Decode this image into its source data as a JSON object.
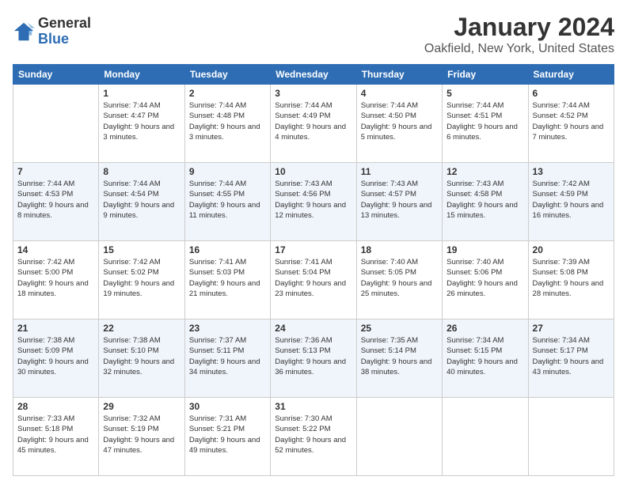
{
  "logo": {
    "general": "General",
    "blue": "Blue"
  },
  "header": {
    "title": "January 2024",
    "subtitle": "Oakfield, New York, United States"
  },
  "weekdays": [
    "Sunday",
    "Monday",
    "Tuesday",
    "Wednesday",
    "Thursday",
    "Friday",
    "Saturday"
  ],
  "weeks": [
    [
      {
        "num": "",
        "sunrise": "",
        "sunset": "",
        "daylight": ""
      },
      {
        "num": "1",
        "sunrise": "Sunrise: 7:44 AM",
        "sunset": "Sunset: 4:47 PM",
        "daylight": "Daylight: 9 hours and 3 minutes."
      },
      {
        "num": "2",
        "sunrise": "Sunrise: 7:44 AM",
        "sunset": "Sunset: 4:48 PM",
        "daylight": "Daylight: 9 hours and 3 minutes."
      },
      {
        "num": "3",
        "sunrise": "Sunrise: 7:44 AM",
        "sunset": "Sunset: 4:49 PM",
        "daylight": "Daylight: 9 hours and 4 minutes."
      },
      {
        "num": "4",
        "sunrise": "Sunrise: 7:44 AM",
        "sunset": "Sunset: 4:50 PM",
        "daylight": "Daylight: 9 hours and 5 minutes."
      },
      {
        "num": "5",
        "sunrise": "Sunrise: 7:44 AM",
        "sunset": "Sunset: 4:51 PM",
        "daylight": "Daylight: 9 hours and 6 minutes."
      },
      {
        "num": "6",
        "sunrise": "Sunrise: 7:44 AM",
        "sunset": "Sunset: 4:52 PM",
        "daylight": "Daylight: 9 hours and 7 minutes."
      }
    ],
    [
      {
        "num": "7",
        "sunrise": "Sunrise: 7:44 AM",
        "sunset": "Sunset: 4:53 PM",
        "daylight": "Daylight: 9 hours and 8 minutes."
      },
      {
        "num": "8",
        "sunrise": "Sunrise: 7:44 AM",
        "sunset": "Sunset: 4:54 PM",
        "daylight": "Daylight: 9 hours and 9 minutes."
      },
      {
        "num": "9",
        "sunrise": "Sunrise: 7:44 AM",
        "sunset": "Sunset: 4:55 PM",
        "daylight": "Daylight: 9 hours and 11 minutes."
      },
      {
        "num": "10",
        "sunrise": "Sunrise: 7:43 AM",
        "sunset": "Sunset: 4:56 PM",
        "daylight": "Daylight: 9 hours and 12 minutes."
      },
      {
        "num": "11",
        "sunrise": "Sunrise: 7:43 AM",
        "sunset": "Sunset: 4:57 PM",
        "daylight": "Daylight: 9 hours and 13 minutes."
      },
      {
        "num": "12",
        "sunrise": "Sunrise: 7:43 AM",
        "sunset": "Sunset: 4:58 PM",
        "daylight": "Daylight: 9 hours and 15 minutes."
      },
      {
        "num": "13",
        "sunrise": "Sunrise: 7:42 AM",
        "sunset": "Sunset: 4:59 PM",
        "daylight": "Daylight: 9 hours and 16 minutes."
      }
    ],
    [
      {
        "num": "14",
        "sunrise": "Sunrise: 7:42 AM",
        "sunset": "Sunset: 5:00 PM",
        "daylight": "Daylight: 9 hours and 18 minutes."
      },
      {
        "num": "15",
        "sunrise": "Sunrise: 7:42 AM",
        "sunset": "Sunset: 5:02 PM",
        "daylight": "Daylight: 9 hours and 19 minutes."
      },
      {
        "num": "16",
        "sunrise": "Sunrise: 7:41 AM",
        "sunset": "Sunset: 5:03 PM",
        "daylight": "Daylight: 9 hours and 21 minutes."
      },
      {
        "num": "17",
        "sunrise": "Sunrise: 7:41 AM",
        "sunset": "Sunset: 5:04 PM",
        "daylight": "Daylight: 9 hours and 23 minutes."
      },
      {
        "num": "18",
        "sunrise": "Sunrise: 7:40 AM",
        "sunset": "Sunset: 5:05 PM",
        "daylight": "Daylight: 9 hours and 25 minutes."
      },
      {
        "num": "19",
        "sunrise": "Sunrise: 7:40 AM",
        "sunset": "Sunset: 5:06 PM",
        "daylight": "Daylight: 9 hours and 26 minutes."
      },
      {
        "num": "20",
        "sunrise": "Sunrise: 7:39 AM",
        "sunset": "Sunset: 5:08 PM",
        "daylight": "Daylight: 9 hours and 28 minutes."
      }
    ],
    [
      {
        "num": "21",
        "sunrise": "Sunrise: 7:38 AM",
        "sunset": "Sunset: 5:09 PM",
        "daylight": "Daylight: 9 hours and 30 minutes."
      },
      {
        "num": "22",
        "sunrise": "Sunrise: 7:38 AM",
        "sunset": "Sunset: 5:10 PM",
        "daylight": "Daylight: 9 hours and 32 minutes."
      },
      {
        "num": "23",
        "sunrise": "Sunrise: 7:37 AM",
        "sunset": "Sunset: 5:11 PM",
        "daylight": "Daylight: 9 hours and 34 minutes."
      },
      {
        "num": "24",
        "sunrise": "Sunrise: 7:36 AM",
        "sunset": "Sunset: 5:13 PM",
        "daylight": "Daylight: 9 hours and 36 minutes."
      },
      {
        "num": "25",
        "sunrise": "Sunrise: 7:35 AM",
        "sunset": "Sunset: 5:14 PM",
        "daylight": "Daylight: 9 hours and 38 minutes."
      },
      {
        "num": "26",
        "sunrise": "Sunrise: 7:34 AM",
        "sunset": "Sunset: 5:15 PM",
        "daylight": "Daylight: 9 hours and 40 minutes."
      },
      {
        "num": "27",
        "sunrise": "Sunrise: 7:34 AM",
        "sunset": "Sunset: 5:17 PM",
        "daylight": "Daylight: 9 hours and 43 minutes."
      }
    ],
    [
      {
        "num": "28",
        "sunrise": "Sunrise: 7:33 AM",
        "sunset": "Sunset: 5:18 PM",
        "daylight": "Daylight: 9 hours and 45 minutes."
      },
      {
        "num": "29",
        "sunrise": "Sunrise: 7:32 AM",
        "sunset": "Sunset: 5:19 PM",
        "daylight": "Daylight: 9 hours and 47 minutes."
      },
      {
        "num": "30",
        "sunrise": "Sunrise: 7:31 AM",
        "sunset": "Sunset: 5:21 PM",
        "daylight": "Daylight: 9 hours and 49 minutes."
      },
      {
        "num": "31",
        "sunrise": "Sunrise: 7:30 AM",
        "sunset": "Sunset: 5:22 PM",
        "daylight": "Daylight: 9 hours and 52 minutes."
      },
      {
        "num": "",
        "sunrise": "",
        "sunset": "",
        "daylight": ""
      },
      {
        "num": "",
        "sunrise": "",
        "sunset": "",
        "daylight": ""
      },
      {
        "num": "",
        "sunrise": "",
        "sunset": "",
        "daylight": ""
      }
    ]
  ]
}
